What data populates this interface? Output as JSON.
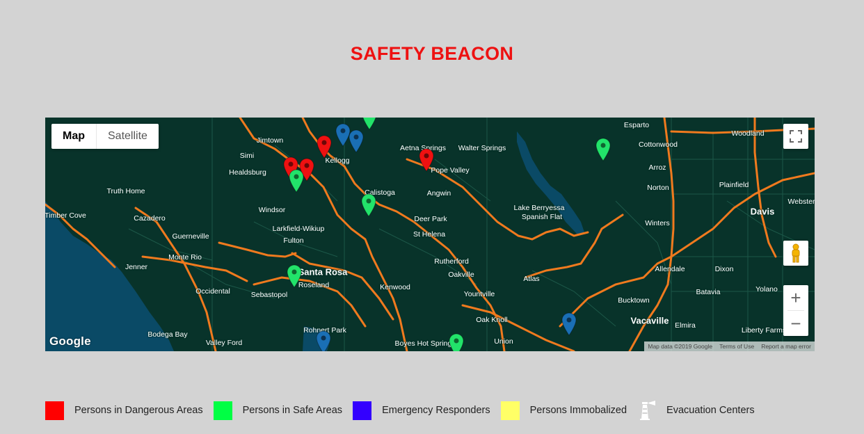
{
  "page": {
    "title": "SAFETY BEACON"
  },
  "map": {
    "map_type_buttons": [
      {
        "label": "Map",
        "active": true
      },
      {
        "label": "Satellite",
        "active": false
      }
    ],
    "controls": {
      "fullscreen_icon": "fullscreen-icon",
      "pegman_icon": "street-view-pegman-icon",
      "zoom_in": "+",
      "zoom_out": "−"
    },
    "logo": "Google",
    "attribution": {
      "map_data": "Map data ©2019 Google",
      "terms": "Terms of Use",
      "report": "Report a map error"
    },
    "colors": {
      "land": "#08332a",
      "water": "#0a4a66",
      "highway": "#f07a1e",
      "road": "#1f5c4c"
    },
    "places": [
      {
        "name": "Jimtown",
        "big": false
      },
      {
        "name": "Simi",
        "big": false
      },
      {
        "name": "Healdsburg",
        "big": false
      },
      {
        "name": "Kellogg",
        "big": false
      },
      {
        "name": "Truth Home",
        "big": false
      },
      {
        "name": "Windsor",
        "big": false
      },
      {
        "name": "Calistoga",
        "big": false
      },
      {
        "name": "Timber Cove",
        "big": false
      },
      {
        "name": "Cazadero",
        "big": false
      },
      {
        "name": "Larkfield-Wikiup",
        "big": false
      },
      {
        "name": "Fulton",
        "big": false
      },
      {
        "name": "Guerneville",
        "big": false
      },
      {
        "name": "Monte Rio",
        "big": false
      },
      {
        "name": "Jenner",
        "big": false
      },
      {
        "name": "Santa Rosa",
        "big": true
      },
      {
        "name": "Roseland",
        "big": false
      },
      {
        "name": "Occidental",
        "big": false
      },
      {
        "name": "Sebastopol",
        "big": false
      },
      {
        "name": "Bodega Bay",
        "big": false
      },
      {
        "name": "Valley Ford",
        "big": false
      },
      {
        "name": "Rohnert Park",
        "big": false
      },
      {
        "name": "Kenwood",
        "big": false
      },
      {
        "name": "Aetna Springs",
        "big": false
      },
      {
        "name": "Walter Springs",
        "big": false
      },
      {
        "name": "Pope Valley",
        "big": false
      },
      {
        "name": "Angwin",
        "big": false
      },
      {
        "name": "Deer Park",
        "big": false
      },
      {
        "name": "St Helena",
        "big": false
      },
      {
        "name": "Rutherford",
        "big": false
      },
      {
        "name": "Oakville",
        "big": false
      },
      {
        "name": "Yountville",
        "big": false
      },
      {
        "name": "Oak Knoll",
        "big": false
      },
      {
        "name": "Boyes Hot Springs",
        "big": false
      },
      {
        "name": "Union",
        "big": false
      },
      {
        "name": "Atlas",
        "big": false
      },
      {
        "name": "Lake Berryessa",
        "big": false
      },
      {
        "name": "Spanish Flat",
        "big": false
      },
      {
        "name": "Esparto",
        "big": false
      },
      {
        "name": "Cottonwood",
        "big": false
      },
      {
        "name": "Arroz",
        "big": false
      },
      {
        "name": "Norton",
        "big": false
      },
      {
        "name": "Woodland",
        "big": false
      },
      {
        "name": "Plainfield",
        "big": false
      },
      {
        "name": "Davis",
        "big": true
      },
      {
        "name": "Webster",
        "big": false
      },
      {
        "name": "Winters",
        "big": false
      },
      {
        "name": "Allendale",
        "big": false
      },
      {
        "name": "Dixon",
        "big": false
      },
      {
        "name": "Batavia",
        "big": false
      },
      {
        "name": "Yolano",
        "big": false
      },
      {
        "name": "Bucktown",
        "big": false
      },
      {
        "name": "Vacaville",
        "big": true
      },
      {
        "name": "Elmira",
        "big": false
      },
      {
        "name": "Liberty Farms",
        "big": false
      }
    ],
    "markers": [
      {
        "category": "danger",
        "color": "#ee1111"
      },
      {
        "category": "danger",
        "color": "#ee1111"
      },
      {
        "category": "danger",
        "color": "#ee1111"
      },
      {
        "category": "danger",
        "color": "#ee1111"
      },
      {
        "category": "safe",
        "color": "#22e36a"
      },
      {
        "category": "safe",
        "color": "#22e36a"
      },
      {
        "category": "safe",
        "color": "#22e36a"
      },
      {
        "category": "safe",
        "color": "#22e36a"
      },
      {
        "category": "safe",
        "color": "#22e36a"
      },
      {
        "category": "safe",
        "color": "#22e36a"
      },
      {
        "category": "evacuation",
        "color": "#1a6fb5"
      },
      {
        "category": "evacuation",
        "color": "#1a6fb5"
      },
      {
        "category": "evacuation",
        "color": "#1a6fb5"
      },
      {
        "category": "evacuation",
        "color": "#1a6fb5"
      }
    ]
  },
  "legend": [
    {
      "label": "Persons in Dangerous Areas",
      "color": "#ff0000",
      "kind": "swatch"
    },
    {
      "label": "Persons in Safe Areas",
      "color": "#00ff44",
      "kind": "swatch"
    },
    {
      "label": "Emergency Responders",
      "color": "#3300ff",
      "kind": "swatch"
    },
    {
      "label": "Persons Immobalized",
      "color": "#ffff66",
      "kind": "swatch"
    },
    {
      "label": "Evacuation Centers",
      "color": "#ffffff",
      "kind": "lighthouse-icon"
    }
  ]
}
